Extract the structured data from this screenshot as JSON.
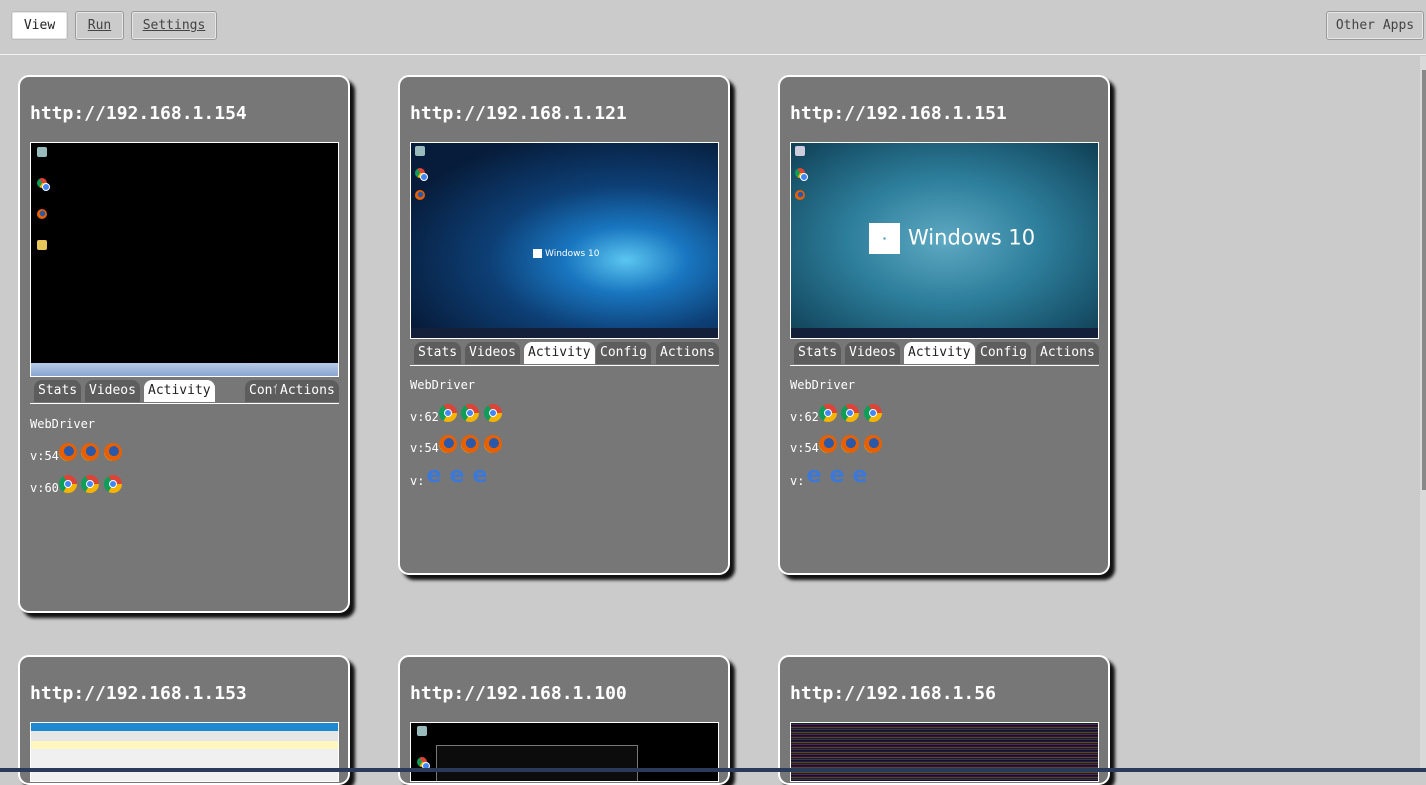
{
  "toolbar": {
    "view_label": "View",
    "run_label": "Run",
    "settings_label": "Settings",
    "other_apps_label": "Other Apps"
  },
  "tabs": [
    "Stats",
    "Videos",
    "Activity",
    "Config",
    "Actions"
  ],
  "active_tab": "Activity",
  "colors": {
    "page_bg": "#cbcbcb",
    "card_bg": "#777777",
    "tab_bg": "#5d5d5d",
    "active_tab_bg": "#ffffff"
  },
  "screenshot_text": {
    "windows_logo": "Windows 10"
  },
  "nodes": [
    {
      "url": "http://192.168.1.154",
      "screenshot": "windows-7-black-desktop",
      "webdriver_label": "WebDriver",
      "versions": [
        {
          "label": "v:54",
          "browser": "firefox-icon",
          "count": 3
        },
        {
          "label": "v:60",
          "browser": "chrome-icon",
          "count": 3
        }
      ]
    },
    {
      "url": "http://192.168.1.121",
      "screenshot": "windows-10-blue-desktop",
      "webdriver_label": "WebDriver",
      "versions": [
        {
          "label": "v:62",
          "browser": "chrome-icon",
          "count": 3
        },
        {
          "label": "v:54",
          "browser": "firefox-icon",
          "count": 3
        },
        {
          "label": "v:",
          "browser": "edge-icon",
          "count": 3
        }
      ]
    },
    {
      "url": "http://192.168.1.151",
      "screenshot": "windows-10-rain-desktop",
      "webdriver_label": "WebDriver",
      "versions": [
        {
          "label": "v:62",
          "browser": "chrome-icon",
          "count": 3
        },
        {
          "label": "v:54",
          "browser": "firefox-icon",
          "count": 3
        },
        {
          "label": "v:",
          "browser": "edge-icon",
          "count": 3
        }
      ]
    },
    {
      "url": "http://192.168.1.153",
      "screenshot": "browser-window-desktop"
    },
    {
      "url": "http://192.168.1.100",
      "screenshot": "console-window-desktop"
    },
    {
      "url": "http://192.168.1.56",
      "screenshot": "noise-desktop"
    }
  ]
}
